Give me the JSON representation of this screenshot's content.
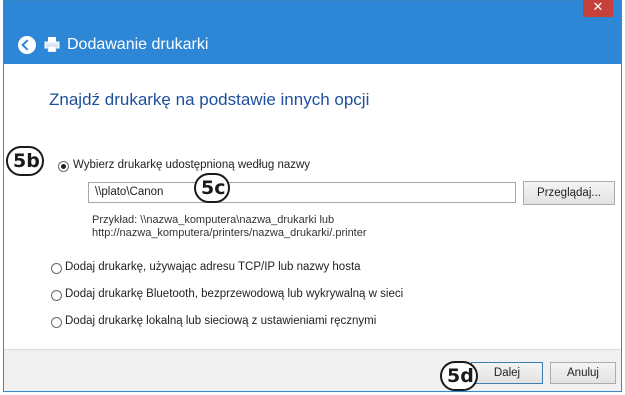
{
  "window": {
    "close_glyph": "✕",
    "title": "Dodawanie drukarki",
    "accent_color": "#2d86d6"
  },
  "content": {
    "heading": "Znajdź drukarkę na podstawie innych opcji",
    "options": [
      {
        "label": "Wybierz drukarkę udostępnioną według nazwy",
        "checked": true
      },
      {
        "label": "Dodaj drukarkę, używając adresu TCP/IP lub nazwy hosta",
        "checked": false
      },
      {
        "label": "Dodaj drukarkę Bluetooth, bezprzewodową lub wykrywalną w sieci",
        "checked": false
      },
      {
        "label": "Dodaj drukarkę lokalną lub sieciową z ustawieniami ręcznymi",
        "checked": false
      }
    ],
    "printer_name_value": "\\\\plato\\Canon",
    "browse_label": "Przeglądaj...",
    "example_line1": "Przykład: \\\\nazwa_komputera\\nazwa_drukarki lub",
    "example_line2": "http://nazwa_komputera/printers/nazwa_drukarki/.printer"
  },
  "footer": {
    "next_label": "Dalej",
    "cancel_label": "Anuluj"
  },
  "callouts": {
    "b": "5b",
    "c": "5c",
    "d": "5d"
  }
}
